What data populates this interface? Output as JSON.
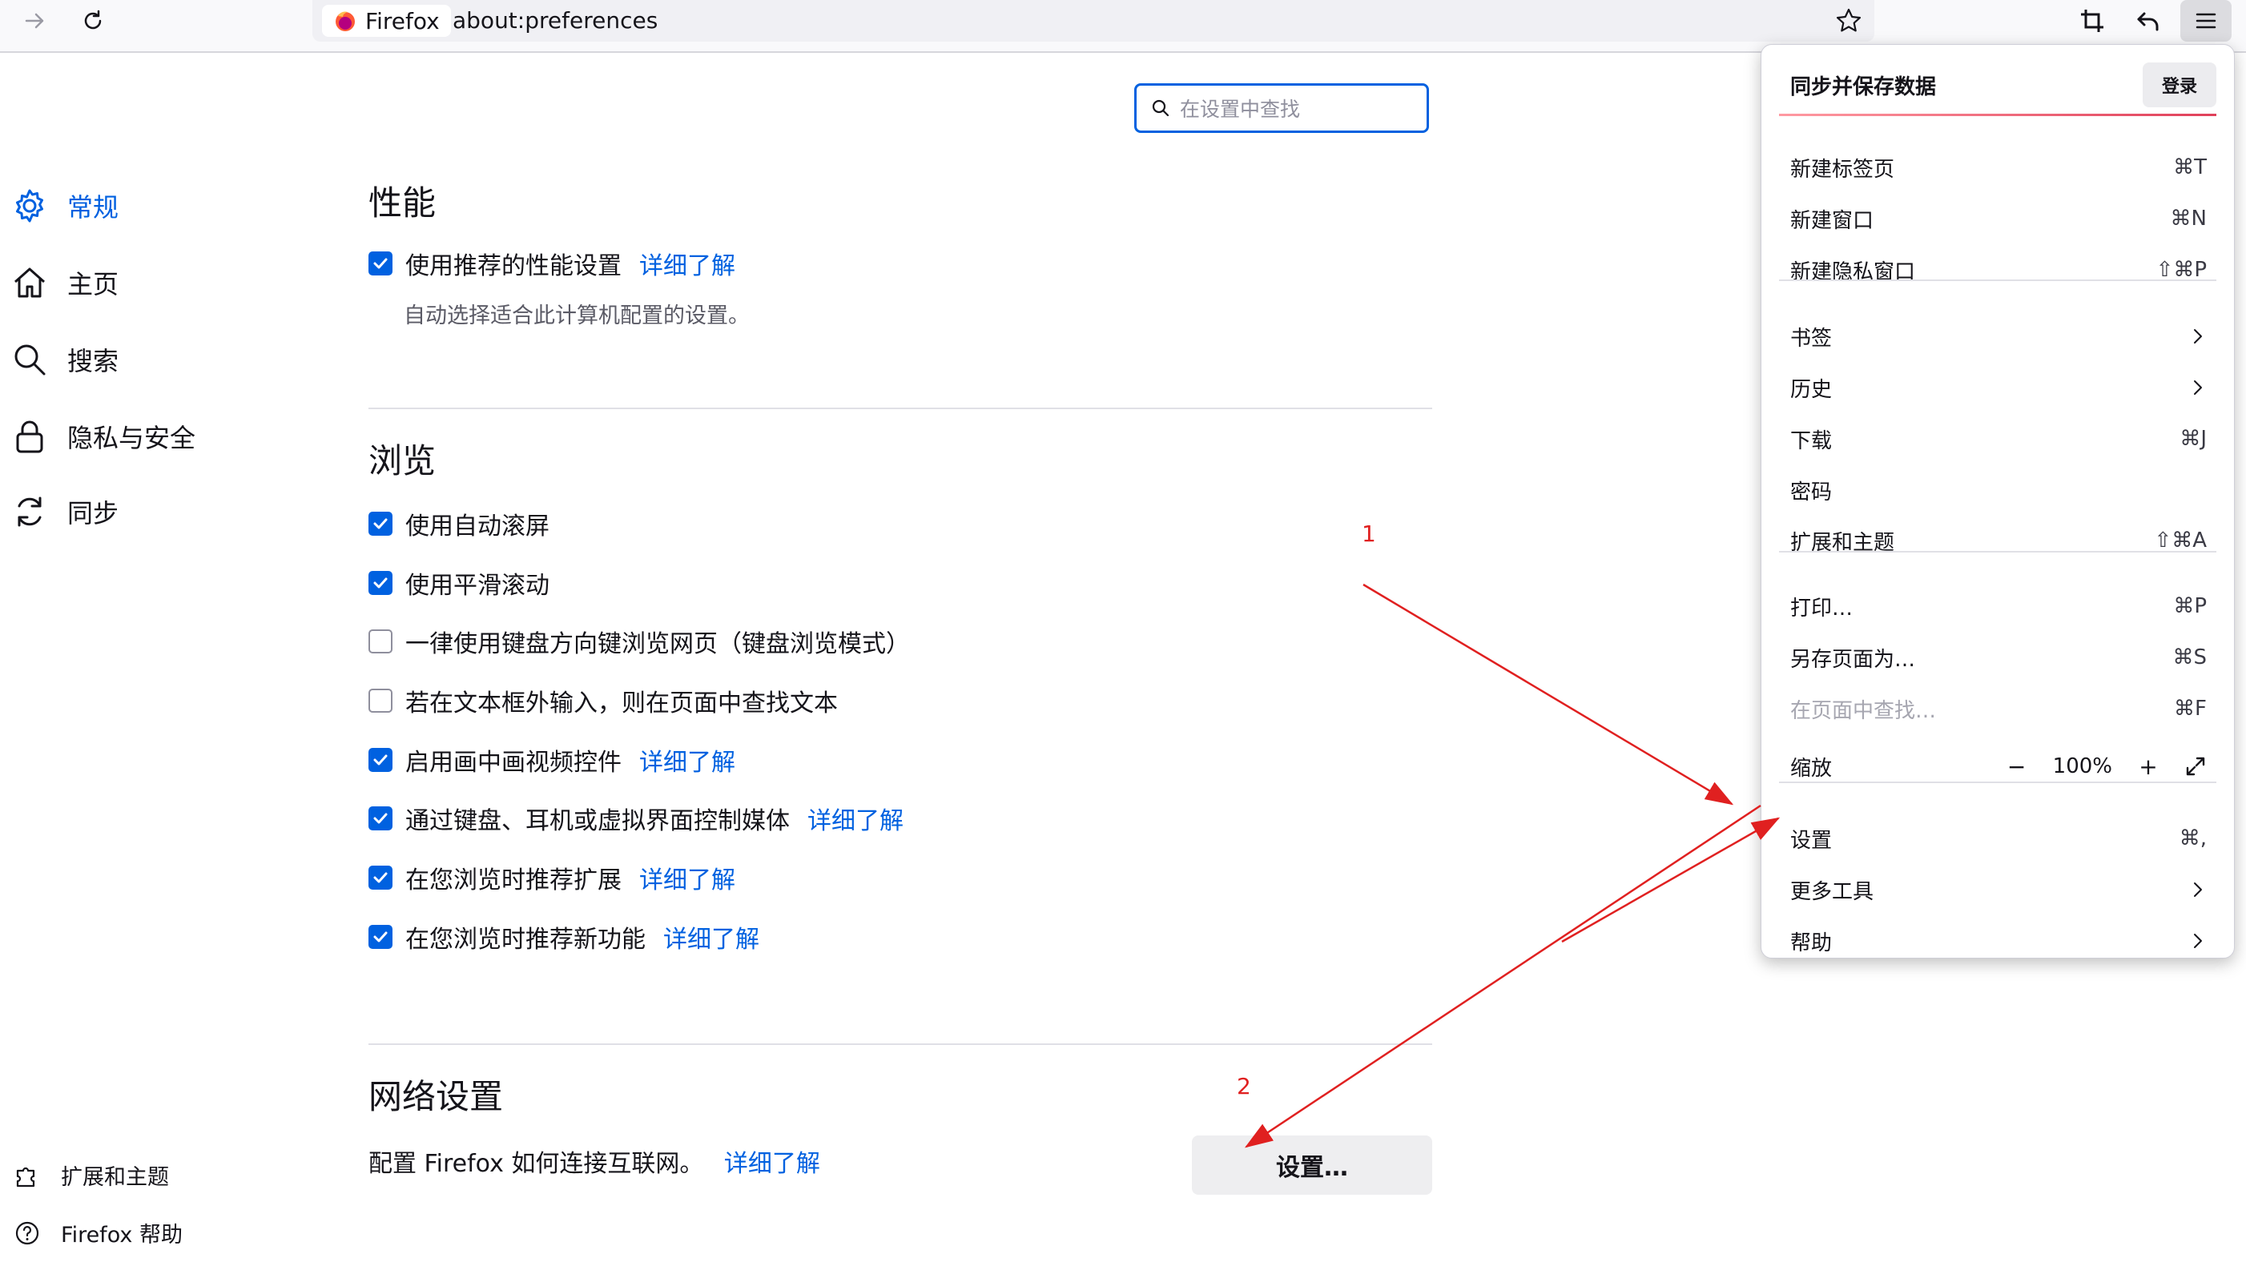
{
  "toolbar": {
    "site_name": "Firefox",
    "url": "about:preferences"
  },
  "search": {
    "placeholder": "在设置中查找"
  },
  "sidebar": {
    "items": [
      {
        "label": "常规",
        "icon": "gear-icon",
        "active": true
      },
      {
        "label": "主页",
        "icon": "home-icon"
      },
      {
        "label": "搜索",
        "icon": "search-icon"
      },
      {
        "label": "隐私与安全",
        "icon": "lock-icon"
      },
      {
        "label": "同步",
        "icon": "sync-icon"
      }
    ],
    "bottom": [
      {
        "label": "扩展和主题",
        "icon": "puzzle-icon"
      },
      {
        "label": "Firefox 帮助",
        "icon": "help-icon"
      }
    ]
  },
  "performance": {
    "heading": "性能",
    "recommended_label": "使用推荐的性能设置",
    "recommended_link": "详细了解",
    "recommended_desc": "自动选择适合此计算机配置的设置。"
  },
  "browsing": {
    "heading": "浏览",
    "options": [
      {
        "label": "使用自动滚屏",
        "checked": true,
        "link": ""
      },
      {
        "label": "使用平滑滚动",
        "checked": true,
        "link": ""
      },
      {
        "label": "一律使用键盘方向键浏览网页（键盘浏览模式）",
        "checked": false,
        "link": ""
      },
      {
        "label": "若在文本框外输入，则在页面中查找文本",
        "checked": false,
        "link": ""
      },
      {
        "label": "启用画中画视频控件",
        "checked": true,
        "link": "详细了解"
      },
      {
        "label": "通过键盘、耳机或虚拟界面控制媒体",
        "checked": true,
        "link": "详细了解"
      },
      {
        "label": "在您浏览时推荐扩展",
        "checked": true,
        "link": "详细了解"
      },
      {
        "label": "在您浏览时推荐新功能",
        "checked": true,
        "link": "详细了解"
      }
    ]
  },
  "network": {
    "heading": "网络设置",
    "desc": "配置 Firefox 如何连接互联网。",
    "link": "详细了解",
    "button": "设置…"
  },
  "app_menu": {
    "sync_label": "同步并保存数据",
    "login_button": "登录",
    "new_tab": {
      "label": "新建标签页",
      "shortcut": "⌘T"
    },
    "new_window": {
      "label": "新建窗口",
      "shortcut": "⌘N"
    },
    "new_private": {
      "label": "新建隐私窗口",
      "shortcut": "⇧⌘P"
    },
    "bookmarks": {
      "label": "书签"
    },
    "history": {
      "label": "历史"
    },
    "downloads": {
      "label": "下载",
      "shortcut": "⌘J"
    },
    "passwords": {
      "label": "密码"
    },
    "addons": {
      "label": "扩展和主题",
      "shortcut": "⇧⌘A"
    },
    "print": {
      "label": "打印…",
      "shortcut": "⌘P"
    },
    "save_as": {
      "label": "另存页面为…",
      "shortcut": "⌘S"
    },
    "find": {
      "label": "在页面中查找…",
      "shortcut": "⌘F"
    },
    "zoom": {
      "label": "缩放",
      "minus": "−",
      "value": "100%",
      "plus": "+"
    },
    "settings": {
      "label": "设置",
      "shortcut": "⌘,"
    },
    "more_tools": {
      "label": "更多工具"
    },
    "help": {
      "label": "帮助"
    }
  },
  "annotations": {
    "step1": "1",
    "step2": "2",
    "color": "#e02020"
  },
  "colors": {
    "accent": "#0061e0",
    "toolbar_bg": "#f9f9fb",
    "annotation": "#e02020"
  }
}
